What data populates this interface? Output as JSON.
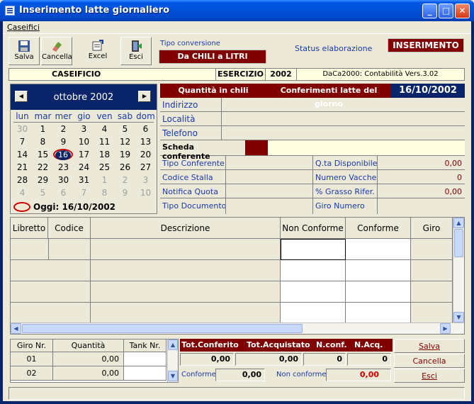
{
  "window": {
    "title": "Inserimento latte giornaliero"
  },
  "menu": {
    "caseifici": "Caseifici"
  },
  "toolbar": {
    "salva": "Salva",
    "cancella": "Cancella",
    "excel": "Excel",
    "esci": "Esci"
  },
  "conversion": {
    "label": "Tipo conversione",
    "value": "Da CHILI a LITRI"
  },
  "status": {
    "label": "Status elaborazione",
    "value": "INSERIMENTO"
  },
  "infobar": {
    "caseificio": "CASEIFICIO",
    "esercizio_label": "ESERCIZIO",
    "esercizio": "2002",
    "version": "DaCa2000: Contabilità Vers.3.02"
  },
  "calendar": {
    "month": "ottobre 2002",
    "dow": [
      "lun",
      "mar",
      "mer",
      "gio",
      "ven",
      "sab",
      "dom"
    ],
    "weeks": [
      [
        "30",
        "1",
        "2",
        "3",
        "4",
        "5",
        "6"
      ],
      [
        "7",
        "8",
        "9",
        "10",
        "11",
        "12",
        "13"
      ],
      [
        "14",
        "15",
        "16",
        "17",
        "18",
        "19",
        "20"
      ],
      [
        "21",
        "22",
        "23",
        "24",
        "25",
        "26",
        "27"
      ],
      [
        "28",
        "29",
        "30",
        "31",
        "1",
        "2",
        "3"
      ],
      [
        "4",
        "5",
        "6",
        "7",
        "8",
        "9",
        "10"
      ]
    ],
    "selected": "16",
    "today_label": "Oggi: 16/10/2002"
  },
  "panel": {
    "quantita": "Quantità in chili",
    "conferimenti": "Conferimenti latte del giorno",
    "date": "16/10/2002",
    "indirizzo": "Indirizzo",
    "localita": "Località",
    "telefono": "Telefono",
    "scheda": "Scheda conferente",
    "tipo_conferente": "Tipo Conferente",
    "codice_stalla": "Codice Stalla",
    "notifica_quota": "Notifica Quota",
    "tipo_documento": "Tipo Documento",
    "qta_disponibile": "Q.ta Disponibile",
    "qta_disponibile_val": "0,00",
    "numero_vacche": "Numero Vacche",
    "numero_vacche_val": "0",
    "grasso": "% Grasso Rifer.",
    "grasso_val": "0,00",
    "giro_numero": "Giro Numero"
  },
  "grid": {
    "cols": [
      "Libretto",
      "Codice",
      "Descrizione",
      "Non Conforme",
      "Conforme",
      "Giro"
    ]
  },
  "giri": {
    "cols": [
      "Giro Nr.",
      "Quantità",
      "Tank Nr."
    ],
    "rows": [
      {
        "giro": "01",
        "qta": "0,00"
      },
      {
        "giro": "02",
        "qta": "0,00"
      }
    ]
  },
  "totals": {
    "tot_conferito": "Tot.Conferito",
    "tot_acquistato": "Tot.Acquistato",
    "n_conf": "N.conf.",
    "n_acq": "N.Acq.",
    "v_conferito": "0,00",
    "v_acquistato": "0,00",
    "v_nconf": "0",
    "v_nacq": "0",
    "conforme_label": "Conforme",
    "conforme_val": "0,00",
    "nonconforme_label": "Non conforme",
    "nonconforme_val": "0,00"
  },
  "actions": {
    "salva": "Salva",
    "cancella": "Cancella",
    "esci": "Esci"
  },
  "colors": {
    "accent": "#800000",
    "title": "#0058e6",
    "label_blue": "#1a3aa8"
  }
}
